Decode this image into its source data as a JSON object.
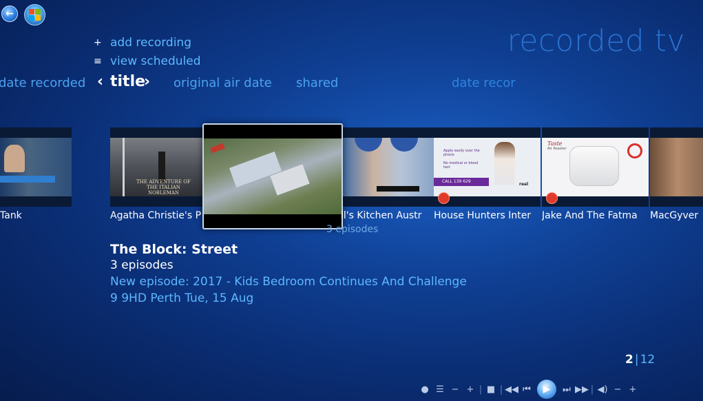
{
  "header": {
    "page_title": "recorded tv"
  },
  "menu": {
    "add_recording": "add recording",
    "view_scheduled": "view scheduled"
  },
  "sort_bar": {
    "left_faded": "date recorded",
    "prev_arrow": "‹",
    "current": "title",
    "next_arrow": "›",
    "original_air_date": "original air date",
    "shared": "shared",
    "right_faded": "date recor"
  },
  "gallery": {
    "items": [
      {
        "label": "Tank"
      },
      {
        "label": "Agatha Christie's P"
      },
      {
        "label": "The Block: Street"
      },
      {
        "label": "ll's Kitchen Austr"
      },
      {
        "label": "House Hunters Inter"
      },
      {
        "label": "Jake And The Fatma"
      },
      {
        "label": "MacGyver"
      }
    ],
    "sub_label": "3 episodes",
    "agatha_overlay": "THE ADVENTURE OF THE ITALIAN NOBLEMAN",
    "ad_text_1": "Apply easily over the phone",
    "ad_text_2": "No medical or blood test",
    "ad_call": "CALL 139 629",
    "ad_brand": "real",
    "jake_brand": "Taste",
    "jake_sub": "Air Roaster"
  },
  "detail": {
    "title": "The Block: Street",
    "episodes": "3 episodes",
    "new_episode": "New episode: 2017 - Kids Bedroom Continues And Challenge",
    "channel_date": "9 9HD Perth  Tue, 15 Aug"
  },
  "pager": {
    "current": "2",
    "separator": "|",
    "total": "12"
  },
  "colors": {
    "accent": "#5db8ff",
    "title": "#2a72cf",
    "record": "#e03a2a"
  }
}
